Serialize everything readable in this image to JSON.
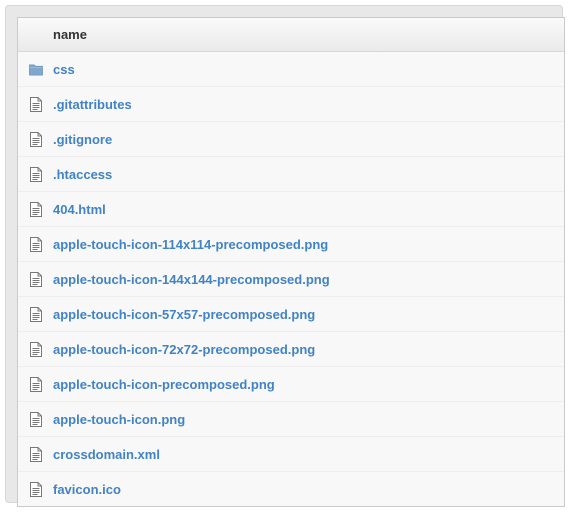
{
  "table": {
    "header": {
      "name_label": "name"
    },
    "rows": [
      {
        "name": "css",
        "icon": "folder-icon"
      },
      {
        "name": ".gitattributes",
        "icon": "file-icon"
      },
      {
        "name": ".gitignore",
        "icon": "file-icon"
      },
      {
        "name": ".htaccess",
        "icon": "file-icon"
      },
      {
        "name": "404.html",
        "icon": "file-icon"
      },
      {
        "name": "apple-touch-icon-114x114-precomposed.png",
        "icon": "file-icon"
      },
      {
        "name": "apple-touch-icon-144x144-precomposed.png",
        "icon": "file-icon"
      },
      {
        "name": "apple-touch-icon-57x57-precomposed.png",
        "icon": "file-icon"
      },
      {
        "name": "apple-touch-icon-72x72-precomposed.png",
        "icon": "file-icon"
      },
      {
        "name": "apple-touch-icon-precomposed.png",
        "icon": "file-icon"
      },
      {
        "name": "apple-touch-icon.png",
        "icon": "file-icon"
      },
      {
        "name": "crossdomain.xml",
        "icon": "file-icon"
      },
      {
        "name": "favicon.ico",
        "icon": "file-icon"
      }
    ]
  },
  "colors": {
    "link": "#4183c4",
    "folder": "#80a6cd",
    "file_icon": "#777777"
  }
}
